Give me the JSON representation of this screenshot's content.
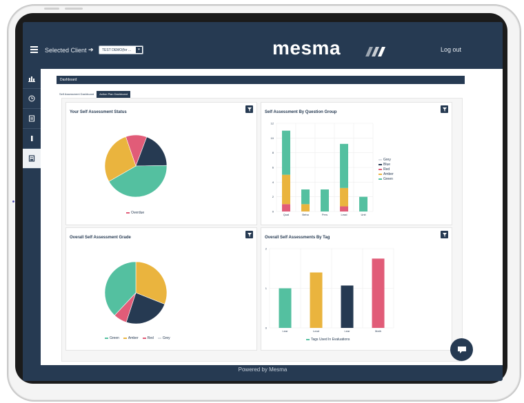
{
  "header": {
    "selected_client_label": "Selected Client",
    "arrow": "➔",
    "client_value": "TEST DEMO(for ...",
    "logo_text": "mesma",
    "logout_label": "Log out"
  },
  "sidebar": {
    "items": [
      "bar-chart-icon",
      "clock-icon",
      "document-icon",
      "bookmark-icon",
      "book-icon"
    ]
  },
  "dashboard": {
    "title": "Dashboard",
    "tabs": [
      "Self Assessment Dashboard",
      "Action Plan Dashboard"
    ],
    "active_tab": "Action Plan Dashboard"
  },
  "footer": {
    "text": "Powered by Mesma"
  },
  "colors": {
    "navy": "#263a52",
    "green": "#54c0a0",
    "amber": "#eab43e",
    "red": "#e15c78",
    "blue": "#263a52",
    "grey": "#d9dde2"
  },
  "chart_data": [
    {
      "type": "pie",
      "title": "Your Self Assessment Status",
      "slices": [
        {
          "label": "Overdue",
          "value": 11,
          "color": "#e15c78"
        },
        {
          "label": "",
          "value": 19,
          "color": "#263a52"
        },
        {
          "label": "",
          "value": 42,
          "color": "#54c0a0"
        },
        {
          "label": "",
          "value": 28,
          "color": "#eab43e"
        }
      ],
      "legend": [
        "Overdue"
      ]
    },
    {
      "type": "bar",
      "title": "Self Assessment By Question Group",
      "categories": [
        "Qual",
        "Beha",
        "Pers",
        "Lead",
        "Unit"
      ],
      "ylim": [
        0,
        12
      ],
      "yticks": [
        0,
        2,
        4,
        6,
        8,
        10,
        12
      ],
      "series": [
        {
          "name": "Red",
          "values": [
            1,
            0,
            0,
            0.7,
            0
          ],
          "color": "#e15c78"
        },
        {
          "name": "Amber",
          "values": [
            4,
            1,
            0,
            2.5,
            0
          ],
          "color": "#eab43e"
        },
        {
          "name": "Green",
          "values": [
            6,
            2,
            3,
            6,
            2
          ],
          "color": "#54c0a0"
        }
      ],
      "legend": [
        "Grey",
        "Blue",
        "Red",
        "Amber",
        "Green"
      ],
      "legend_colors": [
        "#d9dde2",
        "#263a52",
        "#e15c78",
        "#eab43e",
        "#54c0a0"
      ]
    },
    {
      "type": "pie",
      "title": "Overall Self Assessment Grade",
      "slices": [
        {
          "label": "Amber",
          "value": 31,
          "color": "#eab43e"
        },
        {
          "label": "Blue",
          "value": 24,
          "color": "#263a52"
        },
        {
          "label": "Red",
          "value": 7,
          "color": "#e15c78"
        },
        {
          "label": "Green",
          "value": 38,
          "color": "#54c0a0"
        }
      ],
      "legend": [
        "Green",
        "Amber",
        "Red",
        "Grey"
      ],
      "legend_colors": [
        "#54c0a0",
        "#eab43e",
        "#e15c78",
        "#d9dde2"
      ]
    },
    {
      "type": "bar",
      "title": "Overall Self Assessments By Tag",
      "categories": [
        "Lear",
        "Lead",
        "Lear",
        "Math"
      ],
      "ylim": [
        0,
        2
      ],
      "yticks": [
        0,
        1,
        2
      ],
      "values": [
        1,
        1.4,
        1.07,
        1.75
      ],
      "colors": [
        "#54c0a0",
        "#eab43e",
        "#263a52",
        "#e15c78"
      ],
      "legend": [
        "Tags Used In Evaluations"
      ]
    }
  ]
}
